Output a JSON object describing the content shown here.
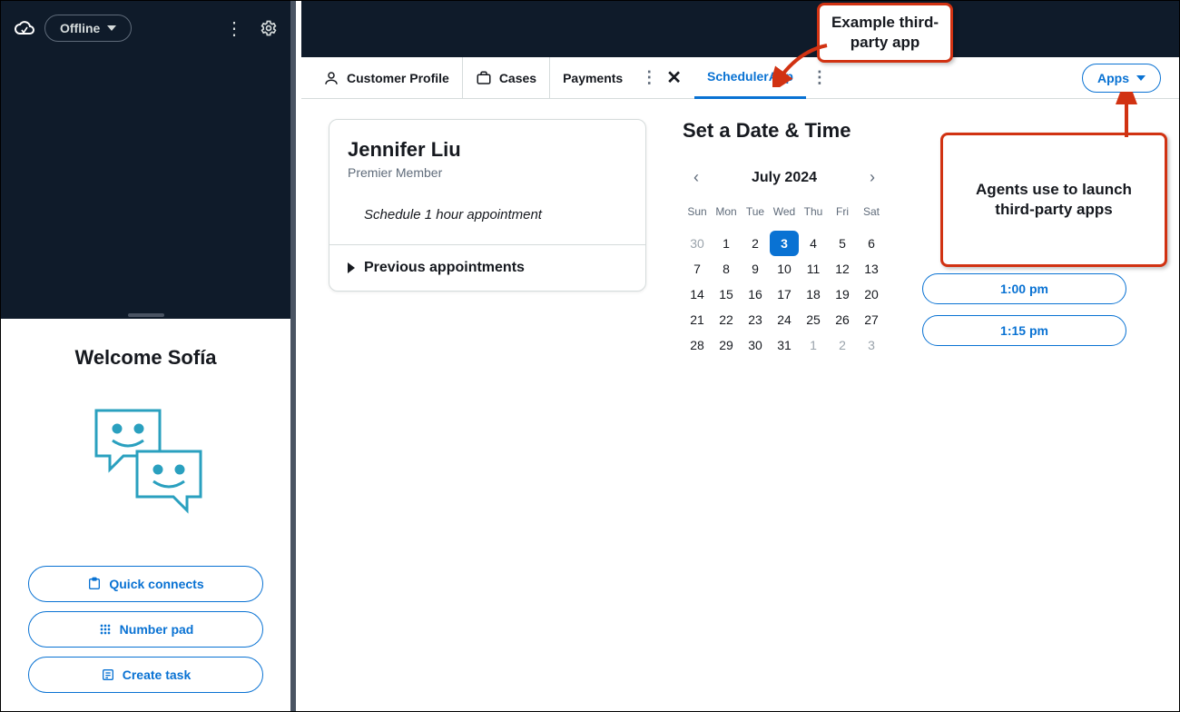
{
  "left": {
    "status": "Offline",
    "welcome": "Welcome Sofía",
    "buttons": {
      "quick_connects": "Quick connects",
      "number_pad": "Number pad",
      "create_task": "Create task"
    }
  },
  "tabs": {
    "customer_profile": "Customer Profile",
    "cases": "Cases",
    "payments": "Payments",
    "scheduler": "SchedulerApp"
  },
  "apps_button": "Apps",
  "customer": {
    "name": "Jennifer Liu",
    "tier": "Premier Member",
    "task": "Schedule 1 hour appointment",
    "previous": "Previous appointments"
  },
  "scheduler": {
    "title": "Set a Date & Time",
    "month": "July 2024",
    "dow": [
      "Sun",
      "Mon",
      "Tue",
      "Wed",
      "Thu",
      "Fri",
      "Sat"
    ],
    "weeks": [
      [
        {
          "n": "30",
          "mute": true
        },
        {
          "n": "1"
        },
        {
          "n": "2"
        },
        {
          "n": "3",
          "sel": true
        },
        {
          "n": "4"
        },
        {
          "n": "5"
        },
        {
          "n": "6"
        }
      ],
      [
        {
          "n": "7"
        },
        {
          "n": "8"
        },
        {
          "n": "9"
        },
        {
          "n": "10"
        },
        {
          "n": "11"
        },
        {
          "n": "12"
        },
        {
          "n": "13"
        }
      ],
      [
        {
          "n": "14"
        },
        {
          "n": "15"
        },
        {
          "n": "16"
        },
        {
          "n": "17"
        },
        {
          "n": "18"
        },
        {
          "n": "19"
        },
        {
          "n": "20"
        }
      ],
      [
        {
          "n": "21"
        },
        {
          "n": "22"
        },
        {
          "n": "23"
        },
        {
          "n": "24"
        },
        {
          "n": "25"
        },
        {
          "n": "26"
        },
        {
          "n": "27"
        }
      ],
      [
        {
          "n": "28"
        },
        {
          "n": "29"
        },
        {
          "n": "30"
        },
        {
          "n": "31"
        },
        {
          "n": "1",
          "mute": true
        },
        {
          "n": "2",
          "mute": true
        },
        {
          "n": "3",
          "mute": true
        }
      ]
    ],
    "slots": [
      "1:00 pm",
      "1:15 pm"
    ]
  },
  "callouts": {
    "third_party": "Example third-party app",
    "apps_launch": "Agents use to launch third-party apps"
  }
}
